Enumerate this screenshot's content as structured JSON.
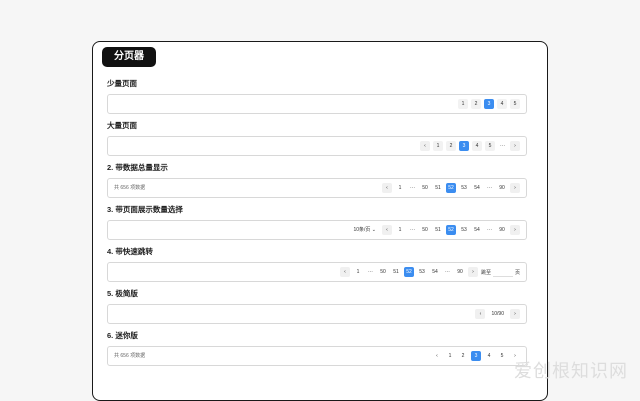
{
  "title": "分页器",
  "sections": [
    {
      "title": "少量页面",
      "pages": [
        "1",
        "2",
        "3",
        "4",
        "5"
      ],
      "active": "3"
    },
    {
      "title": "大量页面",
      "pages": [
        "‹",
        "1",
        "2",
        "3",
        "4",
        "5",
        "···",
        "›"
      ],
      "active": "3"
    },
    {
      "title": "2. 带数据总量显示",
      "total": "共 656 项数据",
      "pages": [
        "‹",
        "1",
        "···",
        "50",
        "51",
        "52",
        "53",
        "54",
        "···",
        "90",
        "›"
      ],
      "active": "52"
    },
    {
      "title": "3. 带页面展示数量选择",
      "size": "10条/页 ⌄",
      "pages": [
        "‹",
        "1",
        "···",
        "50",
        "51",
        "52",
        "53",
        "54",
        "···",
        "90",
        "›"
      ],
      "active": "52"
    },
    {
      "title": "4. 带快速跳转",
      "pages": [
        "‹",
        "1",
        "···",
        "50",
        "51",
        "52",
        "53",
        "54",
        "···",
        "90",
        "›"
      ],
      "active": "52",
      "jump_label": "跳至",
      "jump_unit": "页"
    },
    {
      "title": "5. 极简版",
      "simple": "10/90",
      "pages": [
        "‹",
        "›"
      ]
    },
    {
      "title": "6. 迷你版",
      "total": "共 656 项数据",
      "pages": [
        "‹",
        "1",
        "2",
        "3",
        "4",
        "5",
        "›"
      ],
      "active": "3"
    }
  ],
  "watermark": "爱创根知识网"
}
